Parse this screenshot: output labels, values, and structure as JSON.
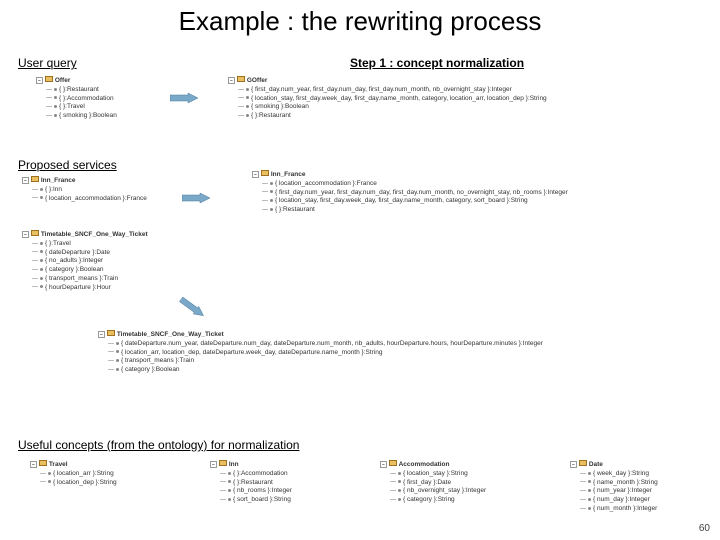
{
  "title": "Example  : the rewriting process",
  "labels": {
    "user_query": "User query",
    "step1": "Step 1 : concept normalization",
    "proposed": "Proposed  services",
    "useful": "Useful concepts (from the ontology) for normalization"
  },
  "page_number": "60",
  "trees": {
    "user_query": {
      "header": "Offer",
      "items": [
        "{ }:Restaurant",
        "{ }:Accommodation",
        "{ }:Travel",
        "{ smoking }:Boolean"
      ]
    },
    "goffer": {
      "header": "GOffer",
      "items": [
        "{ first_day.num_year, first_day.num_day, first_day.num_month, nb_overnight_stay }:Integer",
        "{ location_stay, first_day.week_day, first_day.name_month, category, location_arr, location_dep }:String",
        "{ smoking }:Boolean",
        "{ }:Restaurant"
      ]
    },
    "inn_france_left": {
      "header": "Inn_France",
      "items": [
        "{ }:Inn",
        "{ location_accommodation }:France"
      ]
    },
    "inn_france_right": {
      "header": "Inn_France",
      "items": [
        "{ location_accommodation }:France",
        "{ first_day.num_year, first_day.num_day, first_day.num_month, no_overnight_stay, nb_rooms }:Integer",
        "{ location_stay, first_day.week_day, first_day.name_month, category, sort_board }:String",
        "{ }:Restaurant"
      ]
    },
    "timetable_top": {
      "header": "Timetable_SNCF_One_Way_Ticket",
      "items": [
        "{ }:Travel",
        "{ dateDeparture }:Date",
        "{ no_adults }:Integer",
        "{ category }:Boolean",
        "{ transport_means }:Train",
        "{ hourDeparture }:Hour"
      ]
    },
    "timetable_bot": {
      "header": "Timetable_SNCF_One_Way_Ticket",
      "items": [
        "{ dateDeparture.num_year, dateDeparture.num_day, dateDeparture.num_month, nb_adults, hourDeparture.hours, hourDeparture.minutes }:Integer",
        "{ location_arr, location_dep, dateDeparture.week_day, dateDeparture.name_month }:String",
        "{ transport_means }:Train",
        "{ category }:Boolean"
      ]
    },
    "travel": {
      "header": "Travel",
      "items": [
        "{ location_arr }:String",
        "{ location_dep }:String"
      ]
    },
    "inn": {
      "header": "Inn",
      "items": [
        "{ }:Accommodation",
        "{ }:Restaurant",
        "{ nb_rooms }:Integer",
        "{ sort_board }:String"
      ]
    },
    "accommodation": {
      "header": "Accommodation",
      "items": [
        "{ location_stay }:String",
        "{ first_day }:Date",
        "{ nb_overnight_stay }:Integer",
        "{ category }:String"
      ]
    },
    "date": {
      "header": "Date",
      "items": [
        "{ week_day }:String",
        "{ name_month }:String",
        "{ num_year }:Integer",
        "{ num_day }:Integer",
        "{ num_month }:Integer"
      ]
    }
  }
}
